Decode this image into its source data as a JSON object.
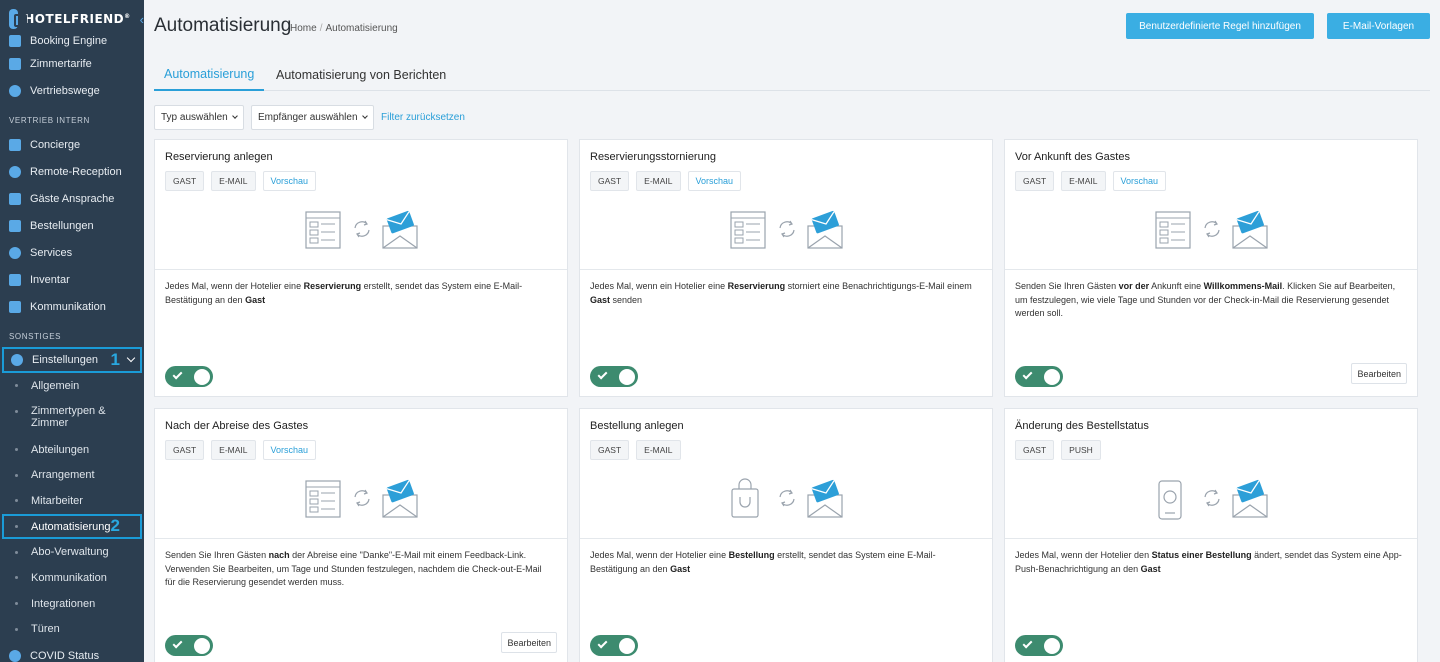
{
  "sidebar": {
    "brand": "HOTELFRIEND",
    "brand_mark": "®",
    "top_items": [
      {
        "label": "Booking Engine",
        "icon": "booking-icon"
      },
      {
        "label": "Zimmertarife",
        "icon": "chart-icon"
      },
      {
        "label": "Vertriebswege",
        "icon": "gear-network-icon"
      }
    ],
    "section_intern": "VERTRIEB INTERN",
    "intern_items": [
      {
        "label": "Concierge",
        "icon": "concierge-icon"
      },
      {
        "label": "Remote-Reception",
        "icon": "reception-icon"
      },
      {
        "label": "Gäste Ansprache",
        "icon": "guest-icon"
      },
      {
        "label": "Bestellungen",
        "icon": "cart-icon"
      },
      {
        "label": "Services",
        "icon": "cloud-icon"
      },
      {
        "label": "Inventar",
        "icon": "inventory-icon"
      },
      {
        "label": "Kommunikation",
        "icon": "chat-icon"
      }
    ],
    "section_other": "SONSTIGES",
    "settings": {
      "label": "Einstellungen",
      "badge": "1"
    },
    "sub_items": [
      {
        "label": "Allgemein"
      },
      {
        "label": "Zimmertypen & Zimmer"
      },
      {
        "label": "Abteilungen"
      },
      {
        "label": "Arrangement"
      },
      {
        "label": "Mitarbeiter"
      },
      {
        "label": "Automatisierung",
        "badge": "2"
      },
      {
        "label": "Abo-Verwaltung"
      },
      {
        "label": "Kommunikation"
      },
      {
        "label": "Integrationen"
      },
      {
        "label": "Türen"
      }
    ],
    "bottom_item": "COVID Status"
  },
  "header": {
    "title": "Automatisierung",
    "breadcrumb_home": "Home",
    "breadcrumb_sep": "/",
    "breadcrumb_current": "Automatisierung",
    "btn_custom_rule": "Benutzerdefinierte Regel hinzufügen",
    "btn_email_templates": "E-Mail-Vorlagen"
  },
  "tabs": [
    "Automatisierung",
    "Automatisierung von Berichten"
  ],
  "filters": {
    "type": "Typ auswählen",
    "recipient": "Empfänger auswählen",
    "reset": "Filter zurücksetzen"
  },
  "cards": [
    {
      "title": "Reservierung anlegen",
      "tags": [
        "GAST",
        "E-MAIL"
      ],
      "preview": "Vorschau",
      "edit": ""
    },
    {
      "title": "Reservierungsstornierung",
      "tags": [
        "GAST",
        "E-MAIL"
      ],
      "preview": "Vorschau",
      "edit": ""
    },
    {
      "title": "Vor Ankunft des Gastes",
      "tags": [
        "GAST",
        "E-MAIL"
      ],
      "preview": "Vorschau",
      "edit": "Bearbeiten"
    },
    {
      "title": "Nach der Abreise des Gastes",
      "tags": [
        "GAST",
        "E-MAIL"
      ],
      "preview": "Vorschau",
      "edit": "Bearbeiten"
    },
    {
      "title": "Bestellung anlegen",
      "tags": [
        "GAST",
        "E-MAIL"
      ],
      "preview": "",
      "edit": ""
    },
    {
      "title": "Änderung des Bestellstatus",
      "tags": [
        "GAST",
        "PUSH"
      ],
      "preview": "",
      "edit": ""
    }
  ],
  "descriptions": {
    "c0": [
      "Jedes Mal, wenn der Hotelier eine ",
      "Reservierung",
      " erstellt, sendet das System eine E-Mail-Bestätigung an den ",
      "Gast"
    ],
    "c1": [
      "Jedes Mal, wenn ein Hotelier eine ",
      "Reservierung",
      " storniert eine Benachrichtigungs-E-Mail einem ",
      "Gast",
      " senden"
    ],
    "c2": [
      "Senden Sie Ihren Gästen ",
      "vor der",
      " Ankunft eine ",
      "Willkommens-Mail",
      ". Klicken Sie auf Bearbeiten, um festzulegen, wie viele Tage und Stunden vor der Check-in-Mail die Reservierung gesendet werden soll."
    ],
    "c3": [
      "Senden Sie Ihren Gästen ",
      "nach",
      " der Abreise eine \"Danke\"-E-Mail mit einem Feedback-Link. Verwenden Sie Bearbeiten, um Tage und Stunden festzulegen, nachdem die Check-out-E-Mail für die Reservierung gesendet werden muss."
    ],
    "c4": [
      "Jedes Mal, wenn der Hotelier eine ",
      "Bestellung",
      " erstellt, sendet das System eine E-Mail-Bestätigung an den ",
      "Gast"
    ],
    "c5": [
      "Jedes Mal, wenn der Hotelier den ",
      "Status einer Bestellung",
      " ändert, sendet das System eine App-Push-Benachrichtigung an den ",
      "Gast"
    ]
  },
  "toggles_on": [
    true,
    true,
    true,
    true,
    true,
    true
  ],
  "colors": {
    "accent": "#3aaee3",
    "sidebar": "#2c3e50",
    "toggle_on": "#3d8b6f",
    "highlight": "#1a9bd7"
  }
}
